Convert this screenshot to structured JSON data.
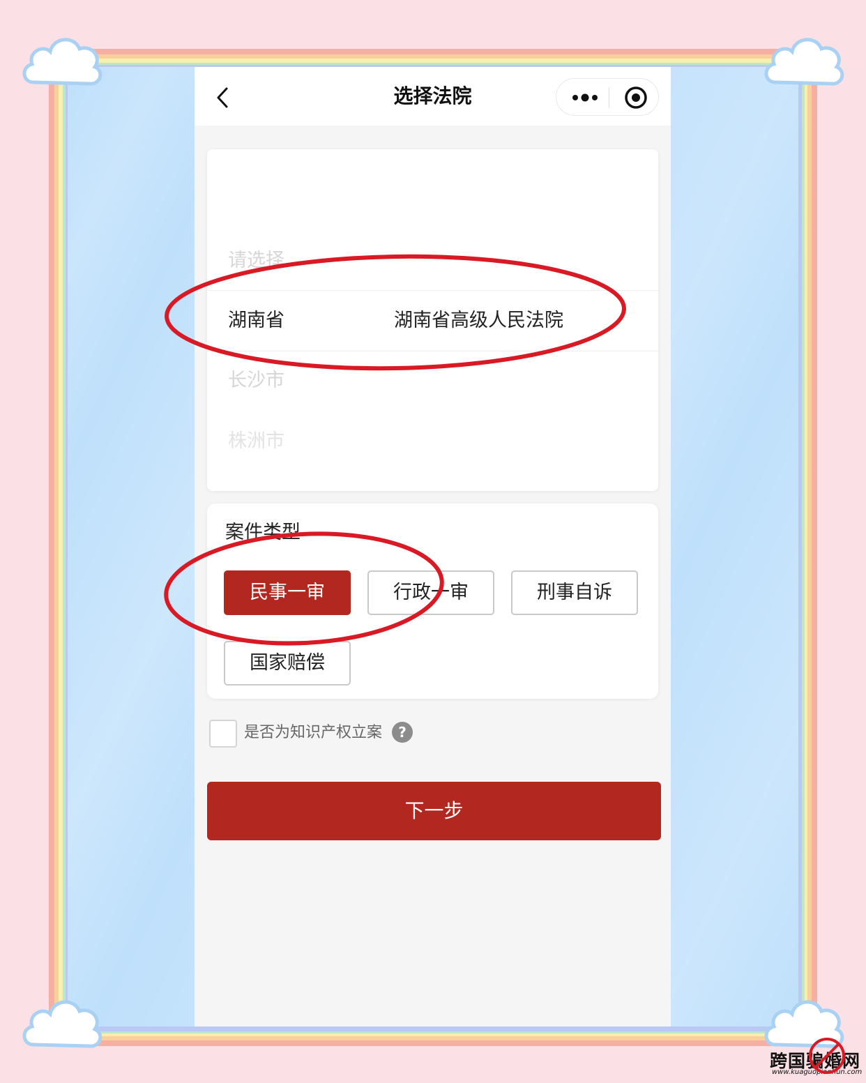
{
  "navbar": {
    "title": "选择法院"
  },
  "court_picker": {
    "placeholder": "请选择",
    "selected_province": "湖南省",
    "selected_court": "湖南省高级人民法院",
    "next_options": [
      "长沙市",
      "株洲市"
    ]
  },
  "case_type": {
    "label": "案件类型",
    "options": [
      "民事一审",
      "行政一审",
      "刑事自诉",
      "国家赔偿"
    ],
    "selected": "民事一审"
  },
  "ip_filing": {
    "label": "是否为知识产权立案",
    "checked": false,
    "help_icon": "question-icon"
  },
  "next_button": {
    "label": "下一步"
  },
  "watermark": {
    "text": "跨国骗婚网",
    "url": "www.kuaguopianhun.com"
  },
  "colors": {
    "accent": "#b2271f",
    "annotation": "#d91a24",
    "panel_blue": "#bfe0fb",
    "background_pink": "#fbe0e6"
  }
}
